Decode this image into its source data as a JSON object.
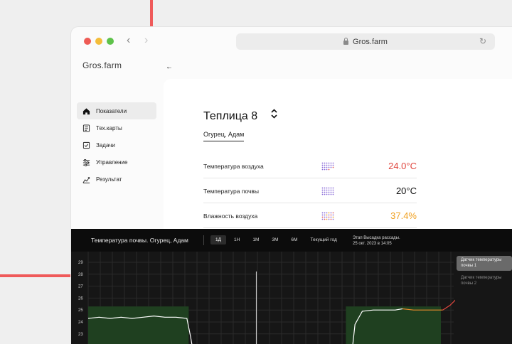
{
  "browser": {
    "url": "Gros.farm",
    "nav_back": "‹",
    "nav_forward": "›",
    "reload": "↻"
  },
  "app": {
    "logo": "Gros.farm",
    "back": "←"
  },
  "sidebar": {
    "items": [
      {
        "label": "Показатели",
        "icon": "home-icon",
        "active": true
      },
      {
        "label": "Тех.карты",
        "icon": "doc-list-icon"
      },
      {
        "label": "Задачи",
        "icon": "task-check-icon"
      },
      {
        "label": "Управление",
        "icon": "sliders-icon"
      },
      {
        "label": "Результат",
        "icon": "growth-chart-icon"
      }
    ]
  },
  "greenhouse": {
    "title": "Теплица 8",
    "switch_icon": "⌃⌄",
    "subtitle": "Огурец, Адам"
  },
  "metrics": [
    {
      "label": "Температура воздуха",
      "value": "24.0°C",
      "color": "#e0473f",
      "dots_icon": "dot-matrix-icon"
    },
    {
      "label": "Температура почвы",
      "value": "20°C",
      "color": "#111111",
      "dots_icon": "dot-matrix-icon"
    },
    {
      "label": "Влажность воздуха",
      "value": "37.4%",
      "color": "#f0a020",
      "dots_icon": "dot-matrix-icon"
    }
  ],
  "chart_panel": {
    "title": "Температура почвы. Огурец, Адам",
    "periods": [
      "1Д",
      "1Н",
      "1М",
      "3М",
      "6М",
      "Текущий год"
    ],
    "active_period": "1Д",
    "stage_line1": "Этап Высадка рассады.",
    "stage_line2": "25 окт. 2023  в 14:05",
    "sensors": [
      {
        "label": "Датчик температуры почвы 1",
        "active": true
      },
      {
        "label": "Датчик температуры почвы 2",
        "active": false
      }
    ]
  },
  "chart_data": {
    "type": "line",
    "yticks": [
      "29",
      "28",
      "27",
      "26",
      "25",
      "24",
      "23"
    ],
    "ylim": [
      22,
      29.5
    ],
    "xlim": [
      0,
      100
    ],
    "optimal_range": [
      22,
      25.3
    ],
    "optimal_bands": [
      [
        0,
        27.5
      ],
      [
        70.5,
        96.5
      ]
    ],
    "marker_x": 46,
    "series": [
      {
        "color": "#ffffff",
        "points": [
          [
            0,
            24.3
          ],
          [
            3,
            24.4
          ],
          [
            6,
            24.3
          ],
          [
            9,
            24.4
          ],
          [
            12,
            24.3
          ],
          [
            15,
            24.4
          ],
          [
            18,
            24.5
          ],
          [
            21,
            24.4
          ],
          [
            24,
            24.4
          ],
          [
            27,
            24.3
          ],
          [
            28,
            22.8
          ],
          [
            29,
            21.0
          ],
          [
            72,
            21.0
          ],
          [
            73,
            23.8
          ],
          [
            75,
            24.9
          ],
          [
            78,
            25.0
          ],
          [
            81,
            25.0
          ],
          [
            84,
            25.0
          ],
          [
            86,
            25.1
          ]
        ]
      },
      {
        "color": "#e88a2a",
        "points": [
          [
            86,
            25.1
          ],
          [
            89,
            25.0
          ],
          [
            92,
            25.0
          ],
          [
            95,
            25.0
          ],
          [
            97,
            25.0
          ]
        ]
      },
      {
        "color": "#e0473f",
        "points": [
          [
            97,
            25.0
          ],
          [
            99,
            25.4
          ],
          [
            101,
            26.0
          ],
          [
            103,
            26.2
          ],
          [
            106,
            26.2
          ],
          [
            108,
            26.3
          ]
        ]
      }
    ],
    "colors": {
      "grid": "#2a2a2a",
      "band": "#1f4020",
      "marker": "#d8d8d8",
      "tick": "#cfcfcf"
    }
  }
}
